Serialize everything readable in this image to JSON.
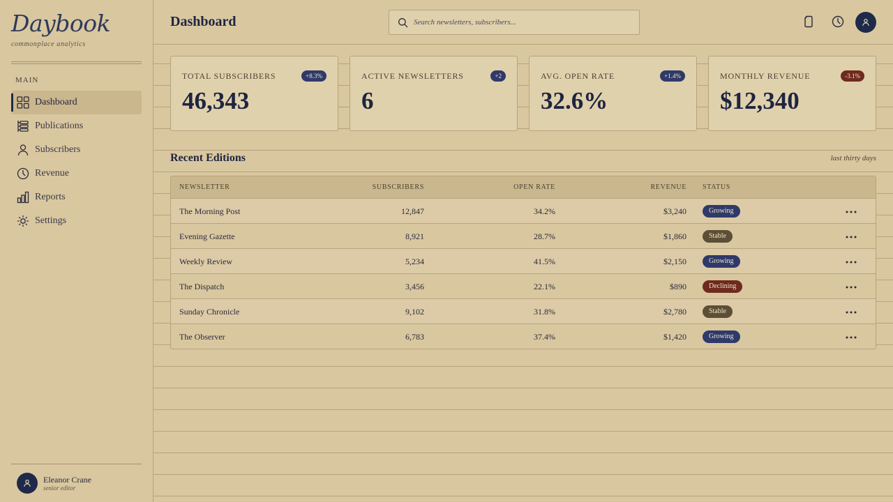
{
  "brand": {
    "title": "Daybook",
    "subtitle": "commonplace analytics"
  },
  "sidebar": {
    "heading": "MAIN",
    "items": [
      {
        "label": "Dashboard",
        "icon": "grid-icon",
        "active": true
      },
      {
        "label": "Publications",
        "icon": "layers-icon"
      },
      {
        "label": "Subscribers",
        "icon": "person-icon"
      },
      {
        "label": "Revenue",
        "icon": "clock-icon"
      },
      {
        "label": "Reports",
        "icon": "bar-chart-icon"
      },
      {
        "label": "Settings",
        "icon": "sun-gear-icon"
      }
    ],
    "user": {
      "name": "Eleanor Crane",
      "role": "senior editor"
    }
  },
  "header": {
    "title": "Dashboard",
    "search_placeholder": "Search newsletters, subscribers..."
  },
  "stats": [
    {
      "label": "TOTAL SUBSCRIBERS",
      "value": "46,343",
      "delta": "+8.3%",
      "trend": "up"
    },
    {
      "label": "ACTIVE NEWSLETTERS",
      "value": "6",
      "delta": "+2",
      "trend": "up"
    },
    {
      "label": "AVG. OPEN RATE",
      "value": "32.6%",
      "delta": "+1.4%",
      "trend": "up"
    },
    {
      "label": "MONTHLY REVENUE",
      "value": "$12,340",
      "delta": "-3.1%",
      "trend": "down"
    }
  ],
  "editions": {
    "title": "Recent Editions",
    "hint": "last thirty days",
    "columns": [
      "NEWSLETTER",
      "SUBSCRIBERS",
      "OPEN RATE",
      "REVENUE",
      "STATUS"
    ],
    "rows": [
      {
        "name": "The Morning Post",
        "subscribers": "12,847",
        "open_rate": "34.2%",
        "revenue": "$3,240",
        "status": "Growing"
      },
      {
        "name": "Evening Gazette",
        "subscribers": "8,921",
        "open_rate": "28.7%",
        "revenue": "$1,860",
        "status": "Stable"
      },
      {
        "name": "Weekly Review",
        "subscribers": "5,234",
        "open_rate": "41.5%",
        "revenue": "$2,150",
        "status": "Growing"
      },
      {
        "name": "The Dispatch",
        "subscribers": "3,456",
        "open_rate": "22.1%",
        "revenue": "$890",
        "status": "Declining"
      },
      {
        "name": "Sunday Chronicle",
        "subscribers": "9,102",
        "open_rate": "31.8%",
        "revenue": "$2,780",
        "status": "Stable"
      },
      {
        "name": "The Observer",
        "subscribers": "6,783",
        "open_rate": "37.4%",
        "revenue": "$1,420",
        "status": "Growing"
      }
    ]
  },
  "colors": {
    "background": "#d9c7a0",
    "accent": "#1f2a4a",
    "growing": "#2f3a6a",
    "stable": "#5d4e36",
    "declining": "#6f2a1e"
  }
}
